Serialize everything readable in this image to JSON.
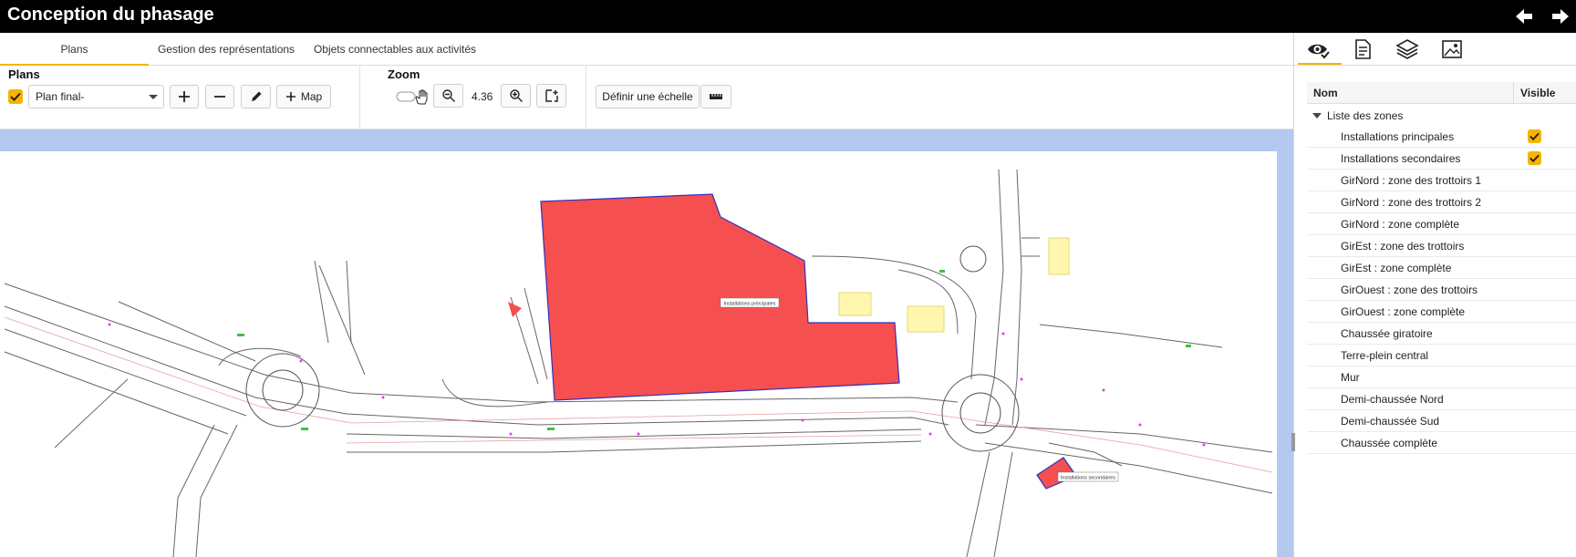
{
  "app": {
    "title": "Conception du phasage"
  },
  "tabs": [
    {
      "label": "Plans",
      "active": true
    },
    {
      "label": "Gestion des représentations",
      "active": false
    },
    {
      "label": "Objets connectables aux activités",
      "active": false
    }
  ],
  "plans": {
    "section_title": "Plans",
    "checked": true,
    "selected_plan": "Plan final-",
    "map_label": "Map"
  },
  "zoom": {
    "section_title": "Zoom",
    "value": "4.36"
  },
  "scale": {
    "define_label": "Définir une échelle"
  },
  "map": {
    "zone_labels": [
      "Installations principales",
      "Installations secondaires"
    ],
    "zone_color": "#f64f4f",
    "background_color": "#b3c9f0"
  },
  "layers": {
    "columns": {
      "name": "Nom",
      "visible": "Visible"
    },
    "group": "Liste des zones",
    "rows": [
      {
        "name": "Installations principales",
        "visible": true
      },
      {
        "name": "Installations secondaires",
        "visible": true
      },
      {
        "name": "GirNord : zone des trottoirs 1",
        "visible": false
      },
      {
        "name": "GirNord : zone des trottoirs 2",
        "visible": false
      },
      {
        "name": "GirNord : zone complète",
        "visible": false
      },
      {
        "name": "GirEst : zone des trottoirs",
        "visible": false
      },
      {
        "name": "GirEst : zone complète",
        "visible": false
      },
      {
        "name": "GirOuest : zone des trottoirs",
        "visible": false
      },
      {
        "name": "GirOuest : zone complète",
        "visible": false
      },
      {
        "name": "Chaussée giratoire",
        "visible": false
      },
      {
        "name": "Terre-plein central",
        "visible": false
      },
      {
        "name": "Mur",
        "visible": false
      },
      {
        "name": "Demi-chaussée Nord",
        "visible": false
      },
      {
        "name": "Demi-chaussée Sud",
        "visible": false
      },
      {
        "name": "Chaussée complète",
        "visible": false
      }
    ]
  },
  "accent_color": "#f5b400"
}
